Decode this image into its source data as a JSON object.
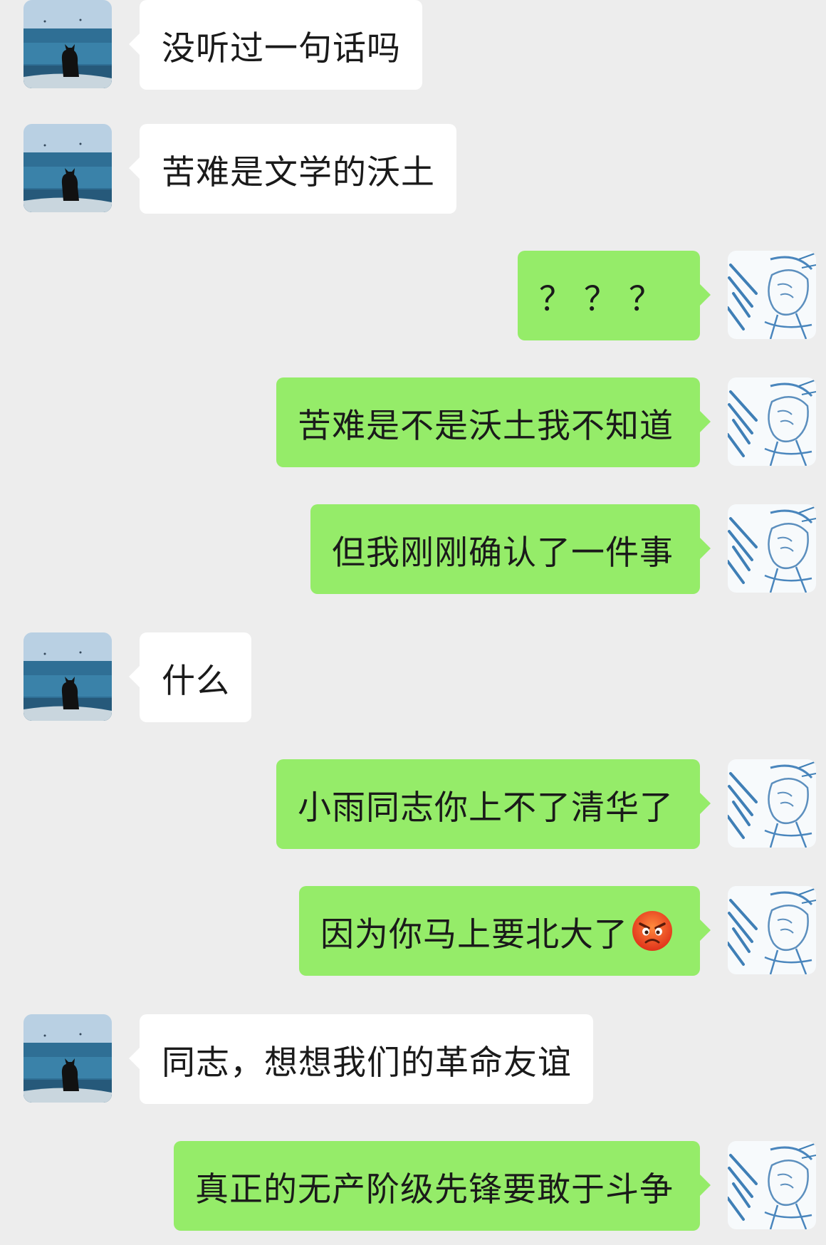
{
  "conversation": {
    "messages": [
      {
        "side": "left",
        "text": "没听过一句话吗"
      },
      {
        "side": "left",
        "text": "苦难是文学的沃土"
      },
      {
        "side": "right",
        "text": "？？？"
      },
      {
        "side": "right",
        "text": "苦难是不是沃土我不知道"
      },
      {
        "side": "right",
        "text": "但我刚刚确认了一件事"
      },
      {
        "side": "left",
        "text": "什么"
      },
      {
        "side": "right",
        "text": "小雨同志你上不了清华了"
      },
      {
        "side": "right",
        "text": "因为你马上要北大了",
        "trailing_icon": "angry-face-emoji"
      },
      {
        "side": "left",
        "text": "同志，想想我们的革命友谊"
      },
      {
        "side": "right",
        "text": "真正的无产阶级先锋要敢于斗争"
      }
    ]
  },
  "colors": {
    "background": "#ededed",
    "incoming_bubble": "#ffffff",
    "outgoing_bubble": "#95ec69",
    "text": "#1a1a1a"
  },
  "avatars": {
    "incoming": "cat-by-sea-avatar",
    "outgoing": "anime-sketch-avatar"
  }
}
